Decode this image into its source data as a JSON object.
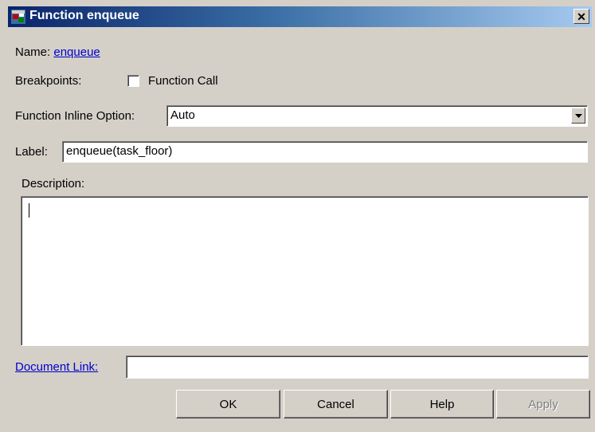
{
  "window": {
    "title": "Function enqueue",
    "close_glyph": "✕",
    "icon": "stateflow-function-icon"
  },
  "name_row": {
    "label": "Name:",
    "value": "enqueue"
  },
  "breakpoints": {
    "label": "Breakpoints:",
    "checkbox_label": "Function Call",
    "checked": false
  },
  "inline_option": {
    "label": "Function Inline Option:",
    "selected": "Auto"
  },
  "label_row": {
    "label": "Label:",
    "value": "enqueue(task_floor)"
  },
  "description": {
    "label": "Description:",
    "value": ""
  },
  "document_link": {
    "label": "Document Link:",
    "value": ""
  },
  "buttons": {
    "ok": "OK",
    "cancel": "Cancel",
    "help": "Help",
    "apply": "Apply"
  },
  "colors": {
    "face": "#d4d0c8",
    "title_start": "#0a246a",
    "title_end": "#a6caf0",
    "link": "#0000cc"
  }
}
